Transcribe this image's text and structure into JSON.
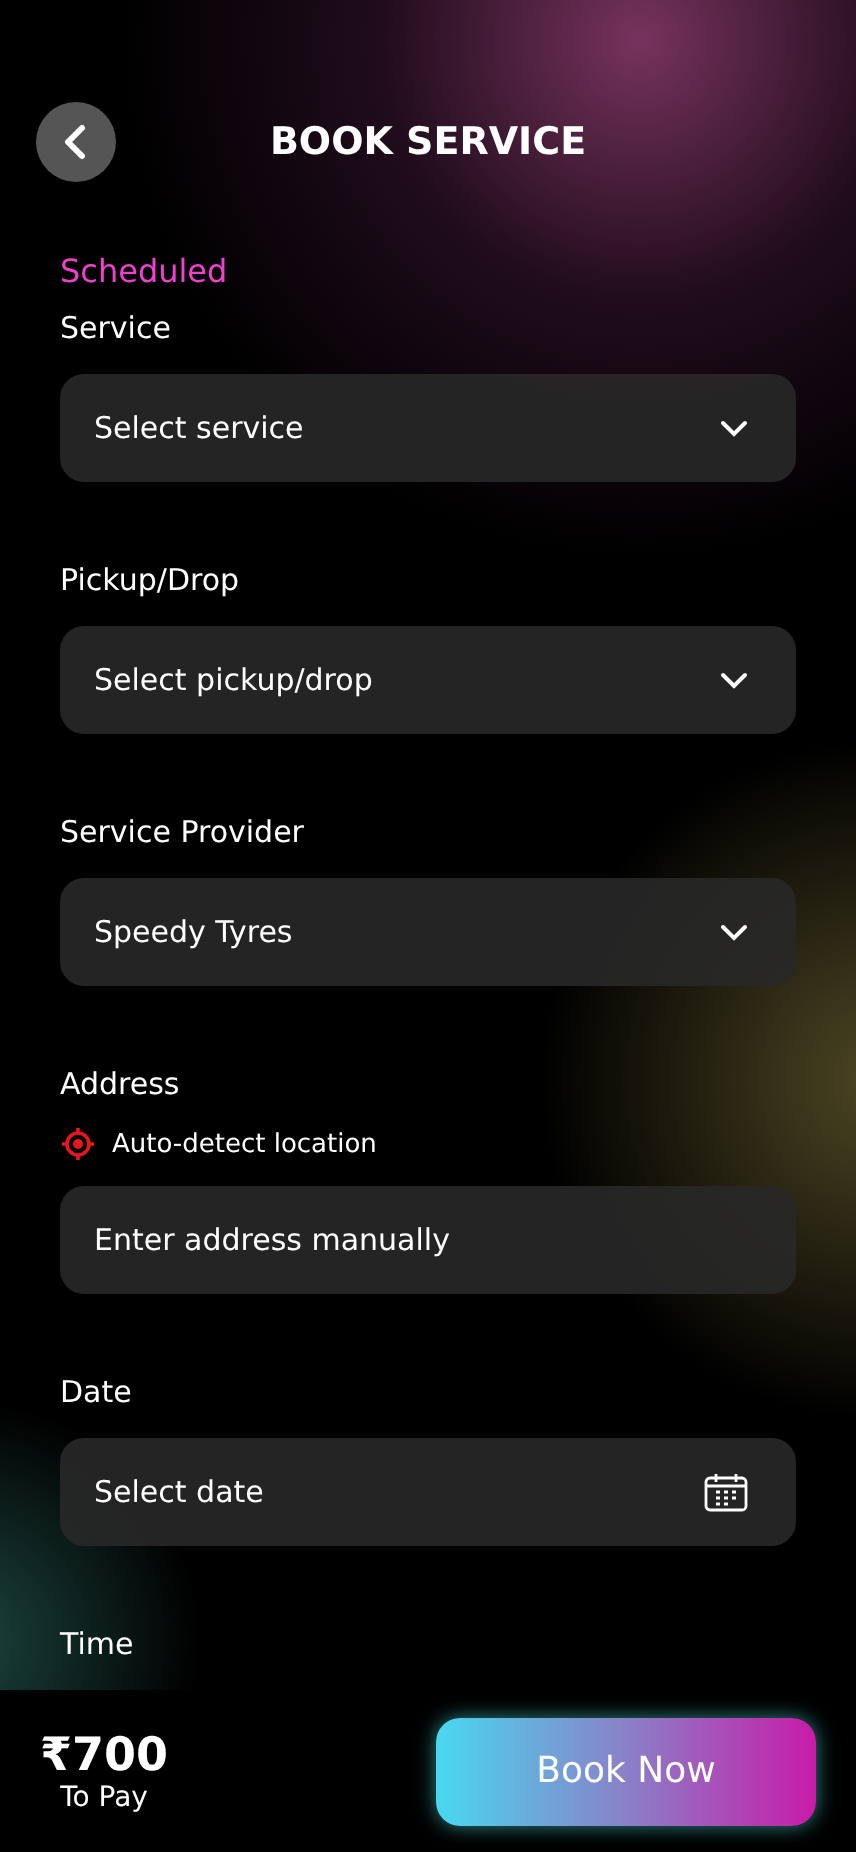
{
  "header": {
    "title": "BOOK SERVICE"
  },
  "mode": "Scheduled",
  "fields": [
    {
      "kind": "select",
      "label": "Service",
      "value": "Select service"
    },
    {
      "kind": "select",
      "label": "Pickup/Drop",
      "value": "Select pickup/drop"
    },
    {
      "kind": "select",
      "label": "Service Provider",
      "value": "Speedy Tyres"
    },
    {
      "kind": "input",
      "label": "Address",
      "auto_detect": "Auto-detect location",
      "placeholder": "Enter address manually"
    },
    {
      "kind": "date",
      "label": "Date",
      "value": "Select date"
    },
    {
      "kind": "label",
      "label": "Time"
    }
  ],
  "footer": {
    "amount": "₹700",
    "amount_caption": "To Pay",
    "button": "Book Now"
  }
}
